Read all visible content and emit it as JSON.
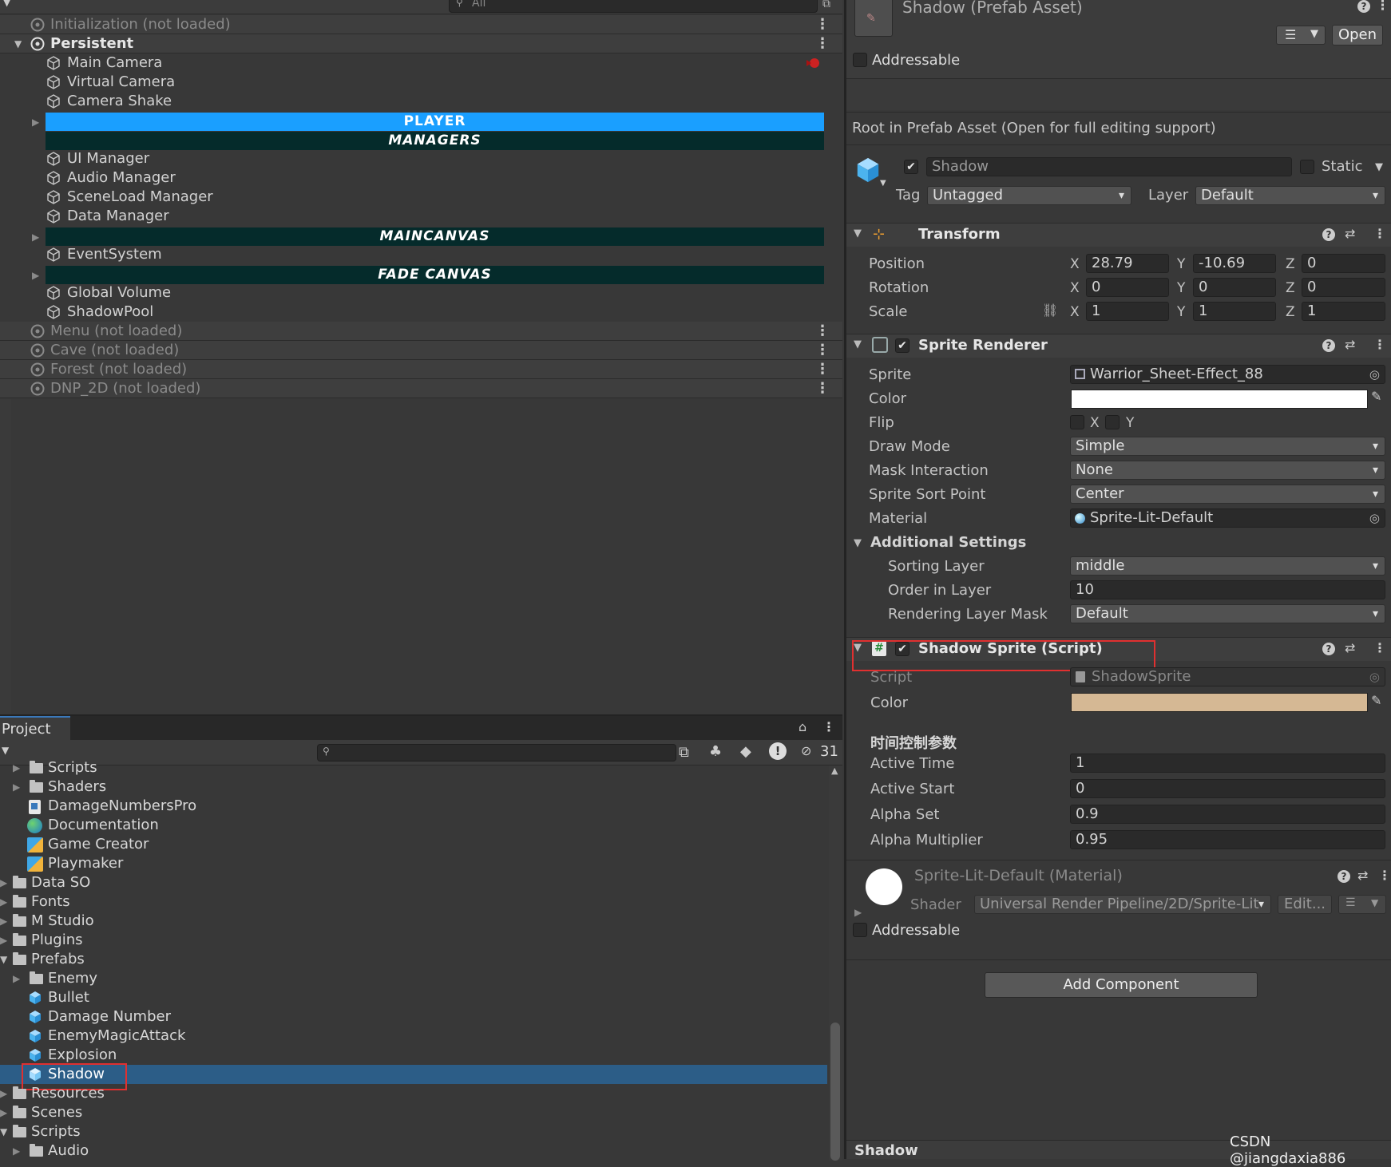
{
  "hierarchy": {
    "search_placeholder": "All",
    "scenes": [
      {
        "label": "Initialization (not loaded)"
      },
      {
        "label": "Persistent"
      },
      {
        "label": "Menu (not loaded)"
      },
      {
        "label": "Cave (not loaded)"
      },
      {
        "label": "Forest (not loaded)"
      },
      {
        "label": "DNP_2D (not loaded)"
      }
    ],
    "objects": {
      "main_camera": "Main Camera",
      "virtual_camera": "Virtual Camera",
      "camera_shake": "Camera Shake",
      "player": "PLAYER",
      "managers": "MANAGERS",
      "ui_manager": "UI Manager",
      "audio_manager": "Audio Manager",
      "sceneload_manager": "SceneLoad Manager",
      "data_manager": "Data Manager",
      "maincanvas": "MAINCANVAS",
      "eventsystem": "EventSystem",
      "fade_canvas": "FADE CANVAS",
      "global_volume": "Global Volume",
      "shadowpool": "ShadowPool"
    },
    "colors": {
      "player_banner": "#1a9fff",
      "dark_banner": "#052b2b"
    }
  },
  "project": {
    "tab": "Project",
    "hidden_count": "31",
    "items": [
      {
        "label": "Scripts"
      },
      {
        "label": "Shaders"
      },
      {
        "label": "DamageNumbersPro"
      },
      {
        "label": "Documentation"
      },
      {
        "label": "Game Creator"
      },
      {
        "label": "Playmaker"
      },
      {
        "label": "Data SO"
      },
      {
        "label": "Fonts"
      },
      {
        "label": "M Studio"
      },
      {
        "label": "Plugins"
      },
      {
        "label": "Prefabs"
      },
      {
        "label": "Enemy"
      },
      {
        "label": "Bullet"
      },
      {
        "label": "Damage Number"
      },
      {
        "label": "EnemyMagicAttack"
      },
      {
        "label": "Explosion"
      },
      {
        "label": "Shadow"
      },
      {
        "label": "Resources"
      },
      {
        "label": "Scenes"
      },
      {
        "label": "Scripts"
      },
      {
        "label": "Audio"
      }
    ]
  },
  "inspector": {
    "title": "Shadow (Prefab Asset)",
    "open_button": "Open",
    "addressable": "Addressable",
    "root_note": "Root in Prefab Asset (Open for full editing support)",
    "object_name": "Shadow",
    "static_label": "Static",
    "tag_label": "Tag",
    "tag_value": "Untagged",
    "layer_label": "Layer",
    "layer_value": "Default",
    "transform": {
      "title": "Transform",
      "position_label": "Position",
      "rotation_label": "Rotation",
      "scale_label": "Scale",
      "axis_x": "X",
      "axis_y": "Y",
      "axis_z": "Z",
      "position": {
        "x": "28.79",
        "y": "-10.69",
        "z": "0"
      },
      "rotation": {
        "x": "0",
        "y": "0",
        "z": "0"
      },
      "scale": {
        "x": "1",
        "y": "1",
        "z": "1"
      }
    },
    "sprite_renderer": {
      "title": "Sprite Renderer",
      "sprite_label": "Sprite",
      "sprite_value": "Warrior_Sheet-Effect_88",
      "color_label": "Color",
      "color_value": "#ffffff",
      "flip_label": "Flip",
      "flip_x": "X",
      "flip_y": "Y",
      "draw_mode_label": "Draw Mode",
      "draw_mode_value": "Simple",
      "mask_label": "Mask Interaction",
      "mask_value": "None",
      "sort_point_label": "Sprite Sort Point",
      "sort_point_value": "Center",
      "material_label": "Material",
      "material_value": "Sprite-Lit-Default",
      "additional": "Additional Settings",
      "sorting_layer_label": "Sorting Layer",
      "sorting_layer_value": "middle",
      "order_label": "Order in Layer",
      "order_value": "10",
      "rlm_label": "Rendering Layer Mask",
      "rlm_value": "Default"
    },
    "shadow_sprite": {
      "title": "Shadow Sprite (Script)",
      "script_label": "Script",
      "script_value": "ShadowSprite",
      "color_label": "Color",
      "color_value": "#d5b894",
      "section": "时间控制参数",
      "active_time_label": "Active Time",
      "active_time_value": "1",
      "active_start_label": "Active Start",
      "active_start_value": "0",
      "alpha_set_label": "Alpha Set",
      "alpha_set_value": "0.9",
      "alpha_mult_label": "Alpha Multiplier",
      "alpha_mult_value": "0.95"
    },
    "material": {
      "title": "Sprite-Lit-Default (Material)",
      "shader_label": "Shader",
      "shader_value": "Universal Render Pipeline/2D/Sprite-Lit",
      "edit_button": "Edit...",
      "addressable": "Addressable"
    },
    "add_component": "Add Component",
    "footer": "Shadow"
  },
  "watermark": "CSDN @jiangdaxia886"
}
